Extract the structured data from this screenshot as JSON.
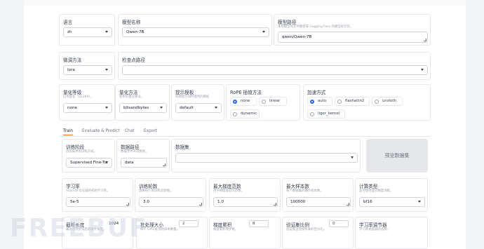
{
  "top_config": {
    "lang": {
      "label": "语言",
      "value": "zh"
    },
    "model_name": {
      "label": "模型名称",
      "value": "Qwen-7B"
    },
    "model_path": {
      "label": "模型路径",
      "hint": "本地模型的文件路径或 Hugging Face 的模型标识符。",
      "value": "qwen/Qwen-7B"
    },
    "finetune": {
      "label": "微调方法",
      "value": "lora"
    },
    "checkpoint": {
      "label": "检查点路径",
      "value": ""
    },
    "quant_bit": {
      "label": "量化等级",
      "hint": "启用量化（QLoRA）。",
      "value": "none"
    },
    "quant_method": {
      "label": "量化方法",
      "hint": "使用的量化算法。",
      "value": "bitsandbytes"
    },
    "template": {
      "label": "提示模板",
      "hint": "构建提示词时使用的模板",
      "value": "default"
    },
    "rope": {
      "label": "RoPE 插值方法",
      "options": [
        "none",
        "linear",
        "dynamic"
      ],
      "selected": "none"
    },
    "booster": {
      "label": "加速方式",
      "options": [
        "auto",
        "flashattn2",
        "unsloth",
        "liger_kernel"
      ],
      "selected": "auto"
    }
  },
  "tabs": [
    "Train",
    "Evaluate & Predict",
    "Chat",
    "Export"
  ],
  "train": {
    "stage": {
      "label": "训练阶段",
      "hint": "目前采用的训练方式。",
      "value": "Supervised Fine-Tur"
    },
    "dataset_dir": {
      "label": "数据路径",
      "hint": "数据文件夹的路径。",
      "value": "data"
    },
    "dataset": {
      "label": "数据集",
      "value": ""
    },
    "preview_button": "预览数据集",
    "learning_rate": {
      "label": "学习率",
      "hint": "AdamW 优化器的初始学习率。",
      "value": "5e-5"
    },
    "epochs": {
      "label": "训练轮数",
      "hint": "需要执行的训练总轮数。",
      "value": "3.0"
    },
    "max_grad_norm": {
      "label": "最大梯度范数",
      "hint": "用于梯度裁剪的范数。",
      "value": "1.0"
    },
    "max_samples": {
      "label": "最大样本数",
      "hint": "每个数据集的最大样本数。",
      "value": "100000"
    },
    "compute_type": {
      "label": "计算类型",
      "hint": "是否使用混合精度训练。",
      "value": "bf16"
    },
    "cutoff_len": {
      "label": "截断长度",
      "hint": "输入序列分词后的最大长度。",
      "value": "1024"
    },
    "batch_size": {
      "label": "批处理大小",
      "hint": "每个 GPU 处理的样本数量。",
      "value": "2"
    },
    "grad_accum": {
      "label": "梯度累积",
      "hint": "梯度累积的步数。",
      "value": "8"
    },
    "val_size": {
      "label": "验证集比例",
      "hint": "验证集占全部样本的百分比。",
      "value": "0"
    },
    "scheduler": {
      "label": "学习率调节器",
      "hint": "学习率调度器的名称。"
    }
  },
  "watermark": "FREEBUF"
}
